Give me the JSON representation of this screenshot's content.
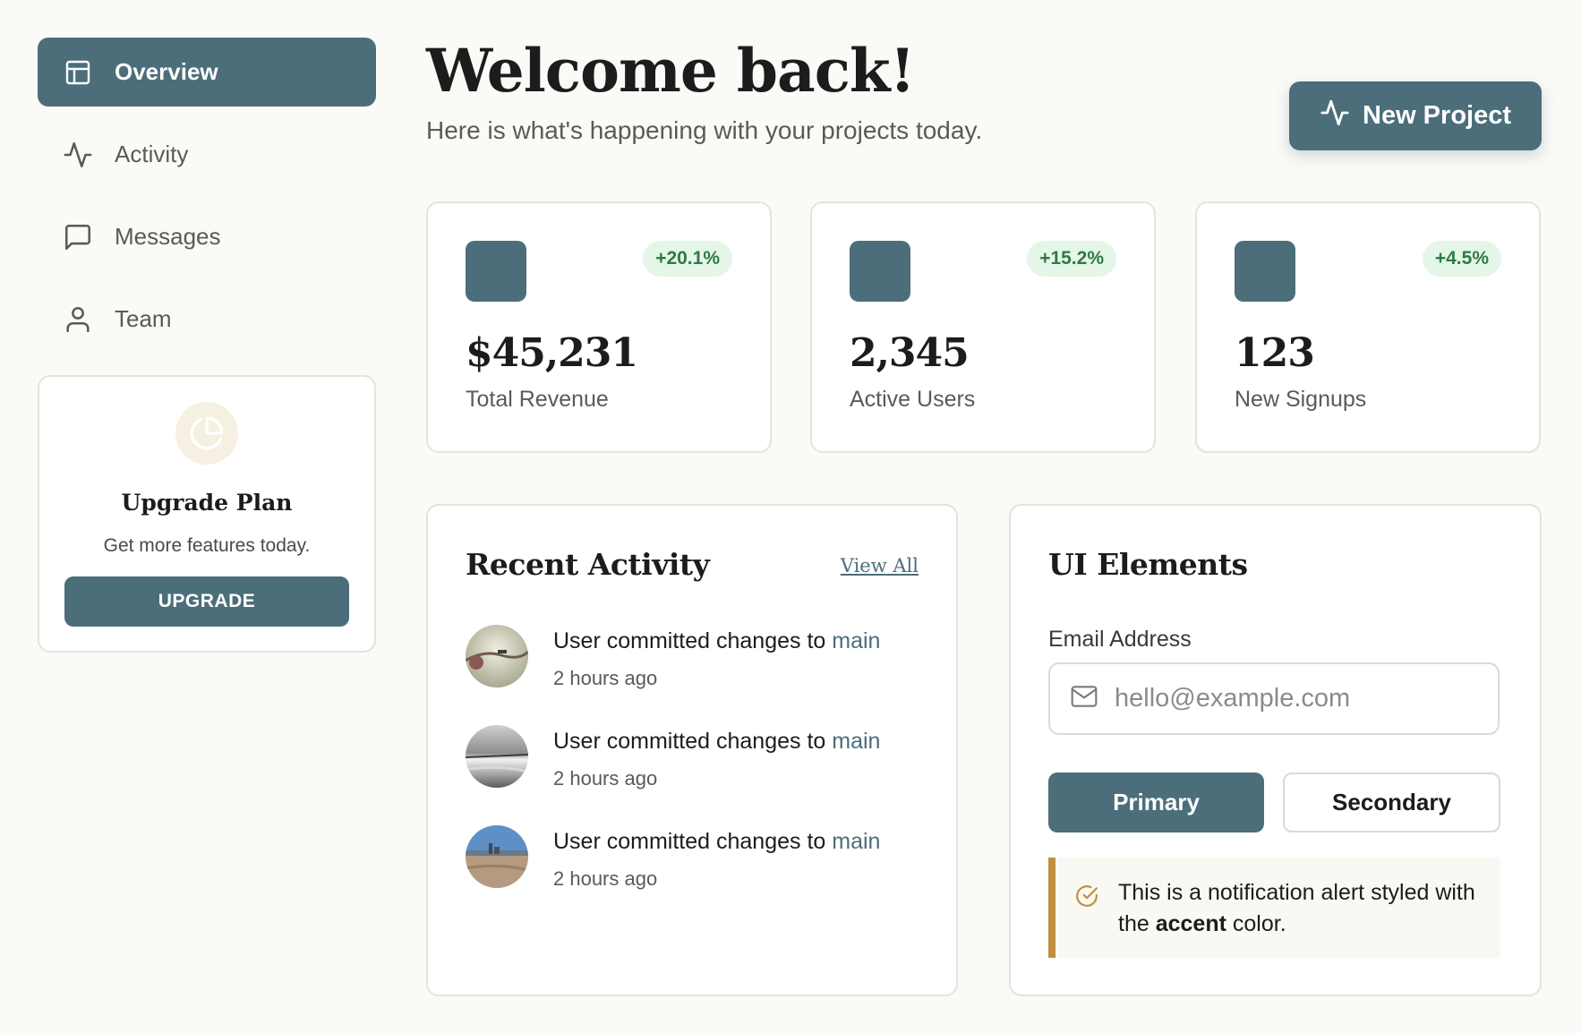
{
  "sidebar": {
    "items": [
      {
        "label": "Overview",
        "icon": "layout-icon",
        "active": true
      },
      {
        "label": "Activity",
        "icon": "pulse-icon",
        "active": false
      },
      {
        "label": "Messages",
        "icon": "message-icon",
        "active": false
      },
      {
        "label": "Team",
        "icon": "user-icon",
        "active": false
      }
    ],
    "upgrade": {
      "title": "Upgrade Plan",
      "subtitle": "Get more features today.",
      "button": "UPGRADE",
      "icon": "pie-chart-icon"
    }
  },
  "header": {
    "title": "Welcome back!",
    "subtitle": "Here is what's happening with your projects today.",
    "new_project_label": "New Project"
  },
  "stats": [
    {
      "value": "$45,231",
      "label": "Total Revenue",
      "change": "+20.1%"
    },
    {
      "value": "2,345",
      "label": "Active Users",
      "change": "+15.2%"
    },
    {
      "value": "123",
      "label": "New Signups",
      "change": "+4.5%"
    }
  ],
  "recent_activity": {
    "title": "Recent Activity",
    "view_all": "View All",
    "items": [
      {
        "prefix": "User committed changes to",
        "branch": "main",
        "time": "2 hours ago"
      },
      {
        "prefix": "User committed changes to",
        "branch": "main",
        "time": "2 hours ago"
      },
      {
        "prefix": "User committed changes to",
        "branch": "main",
        "time": "2 hours ago"
      }
    ]
  },
  "ui_elements": {
    "title": "UI Elements",
    "email_label": "Email Address",
    "email_placeholder": "hello@example.com",
    "primary_label": "Primary",
    "secondary_label": "Secondary",
    "alert": {
      "text_before": "This is a notification alert styled with the",
      "bold": "accent",
      "text_after": "color."
    }
  },
  "colors": {
    "primary": "#4b6e7a",
    "accent": "#c09040",
    "badge_bg": "#e4f6e8",
    "badge_text": "#2f7a44",
    "background": "#fbfaf7"
  }
}
